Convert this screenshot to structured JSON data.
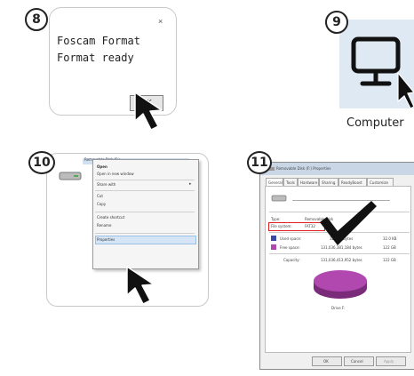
{
  "steps": {
    "s8": "8",
    "s9": "9",
    "s10": "10",
    "s11": "11"
  },
  "dialog": {
    "close_glyph": "×",
    "line1": "Foscam Format",
    "line2": "Format ready",
    "ok_label": "OK"
  },
  "computer": {
    "label": "Computer",
    "icon": "monitor-icon",
    "tile_color": "#dfe9f3"
  },
  "context_menu": {
    "drive_name": "Removable Disk (F:)",
    "items": [
      "Open",
      "Open in new window",
      "Share with",
      "Cut",
      "Copy",
      "Create shortcut",
      "Rename",
      "Properties"
    ],
    "selected": "Properties"
  },
  "properties": {
    "title": "Removable Disk (F:) Properties",
    "tabs": [
      "General",
      "Tools",
      "Hardware",
      "Sharing",
      "ReadyBoost",
      "Customize"
    ],
    "type_label": "Type:",
    "type_value": "Removable Disk",
    "fs_label": "File system:",
    "fs_value": "FAT32",
    "used_label": "Used space:",
    "used_bytes": "32,768 bytes",
    "used_size": "32.0 KB",
    "free_label": "Free space:",
    "free_bytes": "131,036,381,184 bytes",
    "free_size": "122 GB",
    "cap_label": "Capacity:",
    "cap_bytes": "131,036,413,952 bytes",
    "cap_size": "122 GB",
    "drive_caption": "Drive F:",
    "buttons": [
      "OK",
      "Cancel",
      "Apply"
    ],
    "used_color": "#3b4aa8",
    "free_color": "#b048b0",
    "highlight_color": "#e02020"
  }
}
